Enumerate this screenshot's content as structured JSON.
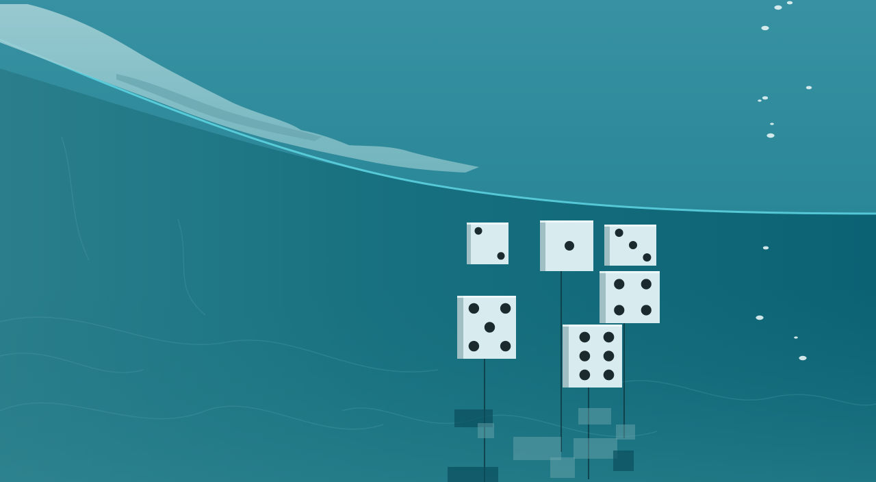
{
  "scene": {
    "type": "underwater-3d-view",
    "colors": {
      "surface_top": "#3791a2",
      "surface_bottom": "#2a8797",
      "water_deep": "#0c6475",
      "water_left": "#2b7f8c",
      "seabed": "#0f6878",
      "foam": "#9cc9cf",
      "waterline": "#5fd6e4",
      "die_face": "#d8ecef",
      "die_side": "#9fbfc4",
      "pip": "#1b2a2c",
      "tether": "#0a3038",
      "bubble": "#e4f3f4"
    }
  },
  "dice": [
    {
      "name": "die-two",
      "value": 2
    },
    {
      "name": "die-one",
      "value": 1
    },
    {
      "name": "die-three",
      "value": 3
    },
    {
      "name": "die-five",
      "value": 5
    },
    {
      "name": "die-four",
      "value": 4
    },
    {
      "name": "die-six",
      "value": 6
    }
  ],
  "bubbles": {
    "count": 12
  }
}
